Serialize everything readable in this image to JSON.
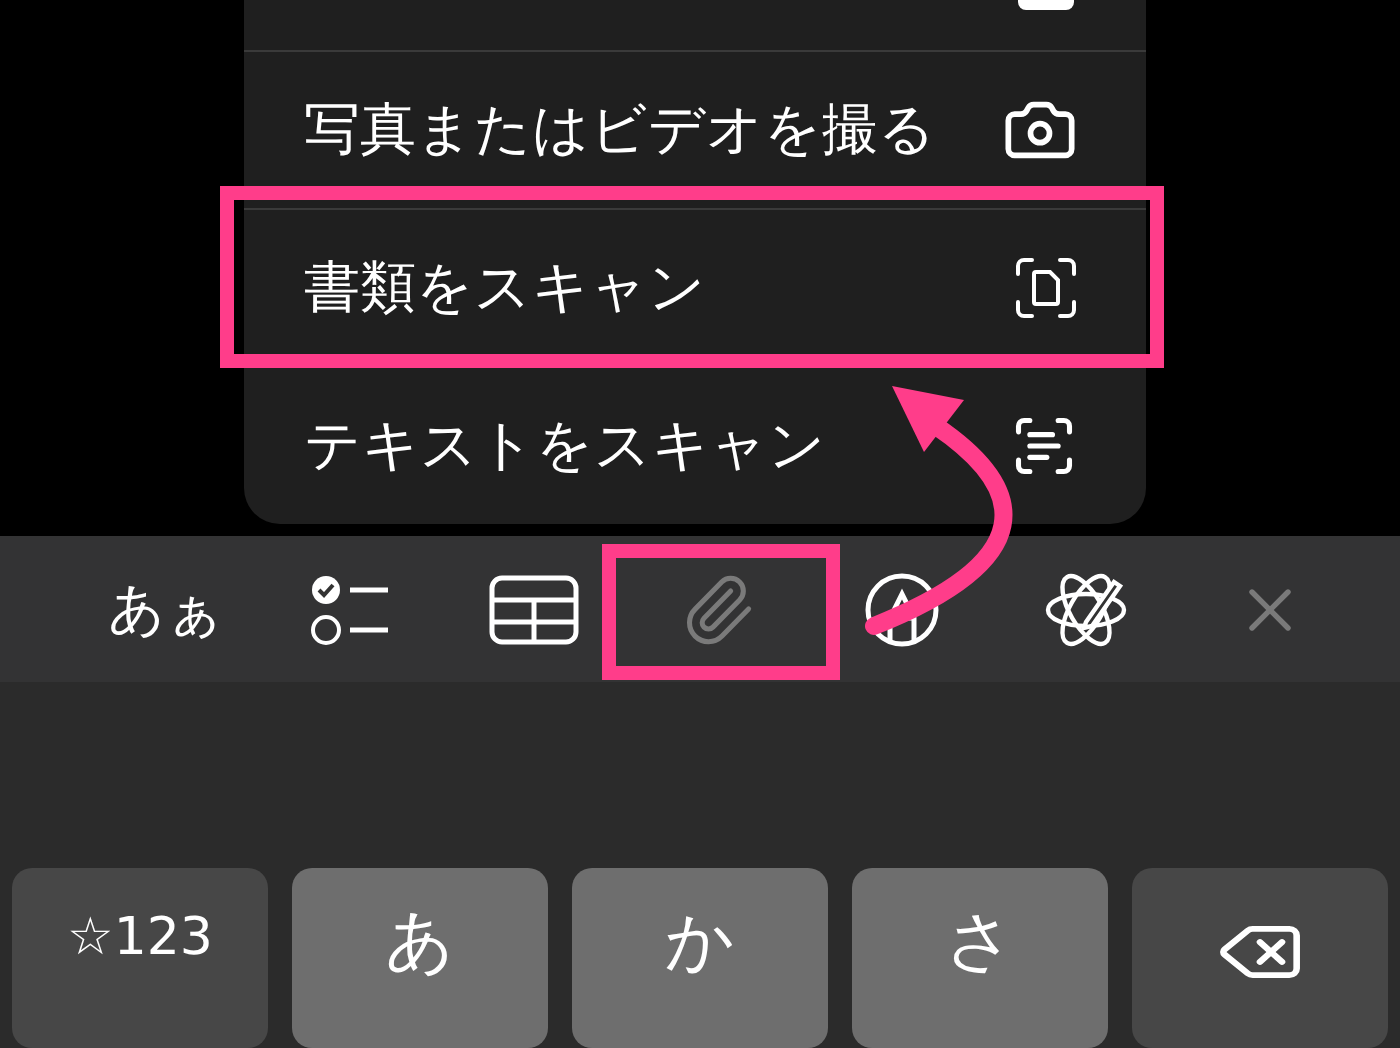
{
  "menu": {
    "items": [
      {
        "kind": "cut"
      },
      {
        "kind": "full",
        "label": "写真またはビデオを撮る",
        "highlighted": false
      },
      {
        "kind": "full",
        "label": "書類をスキャン",
        "highlighted": true
      },
      {
        "kind": "full",
        "label": "テキストをスキャン",
        "highlighted": false
      }
    ]
  },
  "toolbar": {
    "items": [
      {
        "kind": "text",
        "label": "あぁ",
        "disabled": false,
        "highlighted": false
      },
      {
        "kind": "checklist",
        "disabled": false,
        "highlighted": false
      },
      {
        "kind": "table",
        "disabled": false,
        "highlighted": false
      },
      {
        "kind": "attach",
        "disabled": true,
        "highlighted": true
      },
      {
        "kind": "markup",
        "disabled": false,
        "highlighted": false
      },
      {
        "kind": "writing",
        "disabled": false,
        "highlighted": false
      },
      {
        "kind": "close",
        "disabled": true,
        "highlighted": false
      }
    ]
  },
  "keyboard": {
    "keys": [
      {
        "kind": "function",
        "label": "☆123"
      },
      {
        "kind": "letter",
        "label": "あ"
      },
      {
        "kind": "letter",
        "label": "か"
      },
      {
        "kind": "letter",
        "label": "さ"
      },
      {
        "kind": "delete"
      }
    ]
  }
}
